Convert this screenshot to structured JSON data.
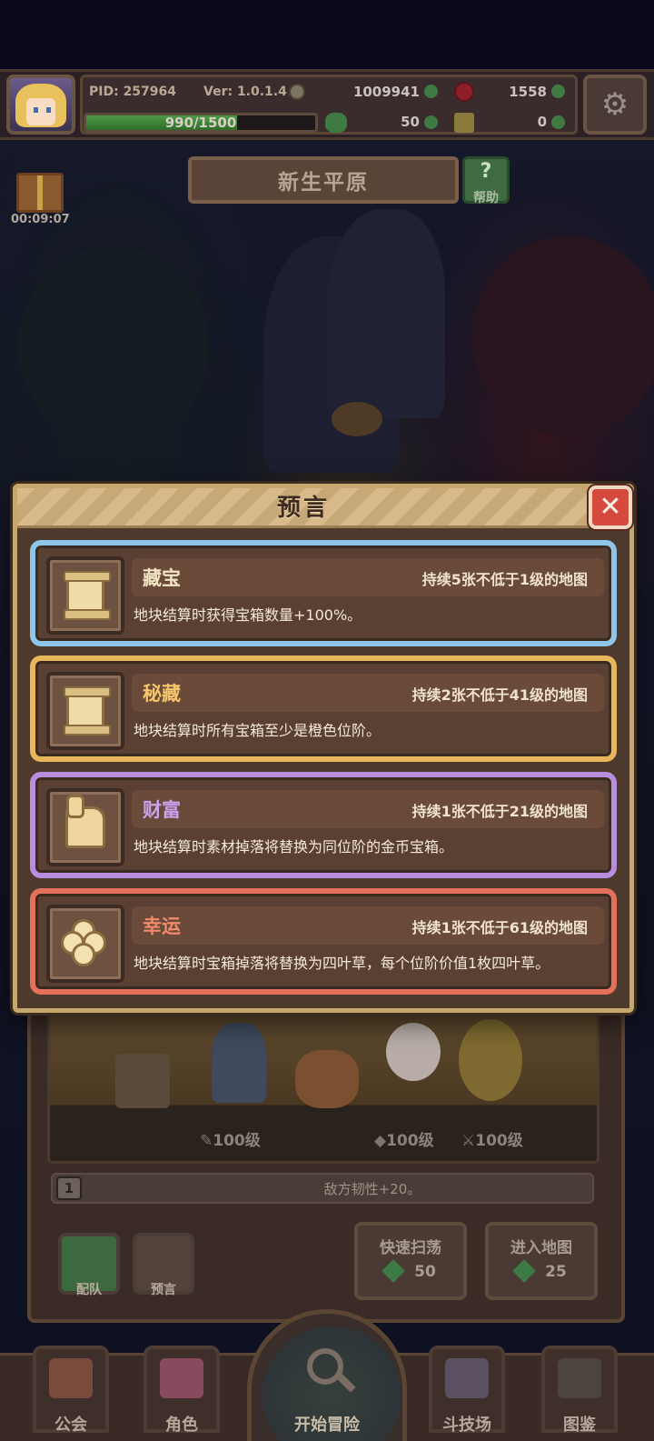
{
  "header": {
    "pid": "PID: 257964",
    "version": "Ver: 1.0.1.4",
    "gold": "1009941",
    "gems": "1558",
    "clover": "50",
    "keys": "0",
    "xp_text": "990/1500",
    "xp_fraction": 0.66
  },
  "map": {
    "title": "新生平原",
    "help_label": "帮助",
    "gift_timer": "00:09:07"
  },
  "modal": {
    "title": "预言",
    "cards": [
      {
        "name": "藏宝",
        "duration": "持续5张不低于1级的地图",
        "desc": "地块结算时获得宝箱数量+100%。",
        "icon": "scroll-icon",
        "border": "#8fc5e8",
        "name_color": "#f3e3c4"
      },
      {
        "name": "秘藏",
        "duration": "持续2张不低于41级的地图",
        "desc": "地块结算时所有宝箱至少是橙色位阶。",
        "icon": "scroll-icon",
        "border": "#e9b75b",
        "name_color": "#f5c56d"
      },
      {
        "name": "财富",
        "duration": "持续1张不低于21级的地图",
        "desc": "地块结算时素材掉落将替换为同位阶的金币宝箱。",
        "icon": "thumbs-up-icon",
        "border": "#b88de0",
        "name_color": "#c9a3f0"
      },
      {
        "name": "幸运",
        "duration": "持续1张不低于61级的地图",
        "desc": "地块结算时宝箱掉落将替换为四叶草，每个位阶价值1枚四叶草。",
        "icon": "clover-icon",
        "border": "#e6715a",
        "name_color": "#f08b6c"
      }
    ]
  },
  "team": {
    "level_1": "100级",
    "level_2": "100级",
    "level_3": "100级",
    "affix_index": "1",
    "affix_text": "敌方韧性+20。",
    "formation_label": "配队",
    "prophecy_label": "预言",
    "sweep_label": "快速扫荡",
    "sweep_cost": "50",
    "enter_label": "进入地图",
    "enter_cost": "25"
  },
  "nav": {
    "guild": "公会",
    "character": "角色",
    "adventure": "开始冒险",
    "arena": "斗技场",
    "codex": "图鉴"
  }
}
